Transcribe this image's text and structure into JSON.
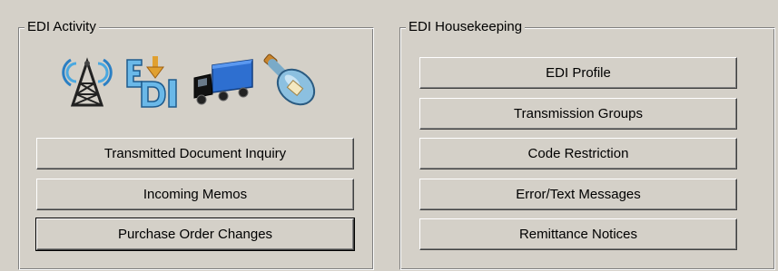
{
  "edi_activity": {
    "title": "EDI Activity",
    "icons": [
      "radio-tower-icon",
      "edi-document-icon",
      "delivery-truck-icon",
      "message-bottle-icon"
    ],
    "buttons": [
      {
        "label": "Transmitted Document Inquiry"
      },
      {
        "label": "Incoming Memos"
      },
      {
        "label": "Purchase Order Changes"
      }
    ]
  },
  "edi_housekeeping": {
    "title": "EDI Housekeeping",
    "buttons": [
      {
        "label": "EDI Profile"
      },
      {
        "label": "Transmission Groups"
      },
      {
        "label": "Code Restriction"
      },
      {
        "label": "Error/Text Messages"
      },
      {
        "label": "Remittance Notices"
      }
    ]
  },
  "colors": {
    "window_background": "#d4d0c8",
    "shadow": "#808080",
    "highlight": "#ffffff"
  }
}
